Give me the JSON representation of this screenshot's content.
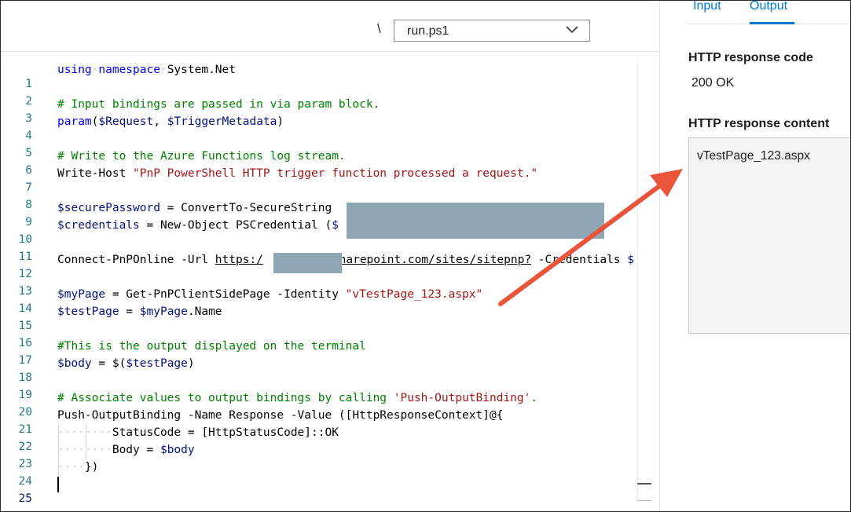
{
  "toolbar": {
    "path_separator": "\\",
    "file_selected": "run.ps1"
  },
  "editor": {
    "line_numbers": [
      "1",
      "2",
      "3",
      "4",
      "5",
      "6",
      "7",
      "8",
      "9",
      "10",
      "11",
      "12",
      "13",
      "14",
      "15",
      "16",
      "17",
      "18",
      "19",
      "20",
      "21",
      "22",
      "23",
      "24",
      "25"
    ],
    "lines": {
      "l1_kw": "using",
      "l1_kw2": "namespace",
      "l1_rest": "System.Net",
      "l3": "# Input bindings are passed in via param block.",
      "l4_kw": "param",
      "l4_open": "(",
      "l4_v1": "$Request",
      "l4_sep": ", ",
      "l4_v2": "$TriggerMetadata",
      "l4_close": ")",
      "l6": "# Write to the Azure Functions log stream.",
      "l7_cmd": "Write-Host ",
      "l7_str": "\"PnP PowerShell HTTP trigger function processed a request.\"",
      "l9_var": "$securePassword",
      "l9_rest": " = ConvertTo-SecureString ",
      "l10_var": "$credentials",
      "l10_rest": " = New-Object PSCredential (",
      "l10_tail": "$",
      "l12_cmd": "Connect-PnPOnline -Url ",
      "l12_url1": "https:/",
      "l12_url2": "sharepoint.com/sites/sitepnp?",
      "l12_rest": " -Credentials ",
      "l12_tail": "$",
      "l14_var": "$myPage",
      "l14_rest": " = Get-PnPClientSidePage -Identity ",
      "l14_str": "\"vTestPage_123.aspx\"",
      "l15_var": "$testPage",
      "l15_eq": " = ",
      "l15_var2": "$myPage",
      "l15_rest": ".Name",
      "l17": "#This is the output displayed on the terminal",
      "l18_var": "$body",
      "l18_eq": " = $(",
      "l18_var2": "$testPage",
      "l18_close": ")",
      "l20_cm": "# Associate values to output bindings by calling ",
      "l20_str": "'Push-OutputBinding'",
      "l20_dot": ".",
      "l21": "Push-OutputBinding -Name Response -Value ([HttpResponseContext]@{",
      "l22_ws": "········",
      "l22": "StatusCode = [HttpStatusCode]::OK",
      "l23_ws": "········",
      "l23_code": "Body = ",
      "l23_var": "$body",
      "l24_ws": "····",
      "l24": "})"
    }
  },
  "panel": {
    "tabs": [
      {
        "label": "Input"
      },
      {
        "label": "Output"
      }
    ],
    "active_tab": "Output",
    "response_code_label": "HTTP response code",
    "response_code_value": "200 OK",
    "response_content_label": "HTTP response content",
    "response_content_value": "vTestPage_123.aspx"
  },
  "colors": {
    "accent": "#0078d4",
    "arrow": "#e8553b",
    "redaction": "#8fa6b4"
  }
}
